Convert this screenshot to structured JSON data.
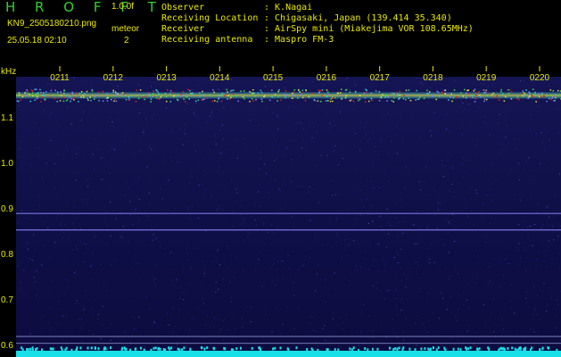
{
  "header": {
    "title": "H R O F F T",
    "resolution": "1.0.0f",
    "file_name": "KN9_2505180210.png",
    "meteor_label": "meteor",
    "meteor_count": "2",
    "datetime": "25.05.18 02:10"
  },
  "info": [
    {
      "label": "Observer",
      "value": ": K.Nagai"
    },
    {
      "label": "Receiving Location",
      "value": ": Chigasaki, Japan (139.414 35.340)"
    },
    {
      "label": "Receiver",
      "value": ": AirSpy mini (Miakejima VOR 108.65MHz)"
    },
    {
      "label": "Receiving antenna",
      "value": ": Maspro FM-3"
    }
  ],
  "colors": {
    "text": "#e8e800",
    "title": "#2fd12f",
    "background": "#000000",
    "noise_floor": "#10104a",
    "signal_line": "#8a8aff",
    "baseline": "#18e0e8"
  },
  "chart_data": {
    "type": "heatmap",
    "title": "H R O F F T",
    "ylabel": "kHz",
    "x": [
      "0211",
      "0212",
      "0213",
      "0214",
      "0215",
      "0216",
      "0217",
      "0218",
      "0219",
      "0220"
    ],
    "yticks": [
      "1.1",
      "1.0",
      "0.9",
      "0.8",
      "0.7",
      "0.6"
    ],
    "ylim": [
      0.575,
      1.19
    ],
    "carrier_band_khz": 1.15,
    "horizontal_lines_khz": [
      0.89,
      0.854,
      0.62,
      0.605,
      0.588
    ],
    "grid": false
  }
}
